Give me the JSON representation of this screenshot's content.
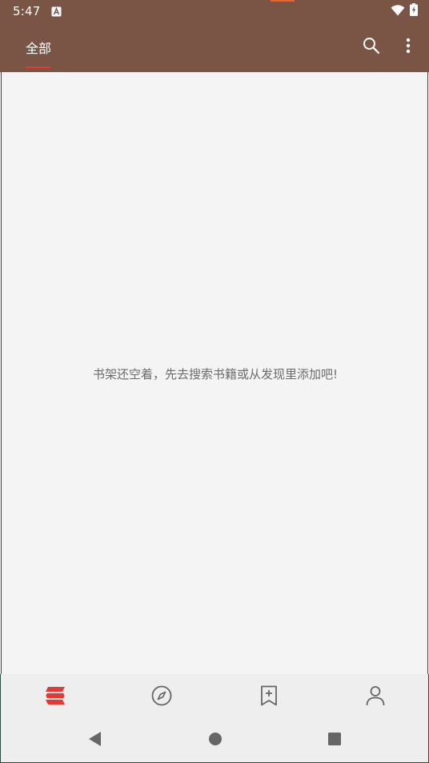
{
  "status_bar": {
    "time": "5:47",
    "icons": [
      "keyboard-a-icon",
      "wifi-icon",
      "battery-charging-icon"
    ]
  },
  "toolbar": {
    "tab_label": "全部",
    "search_icon": "search-icon",
    "more_icon": "more-vertical-icon"
  },
  "main": {
    "empty_message": "书架还空着，先去搜索书籍或从发现里添加吧!"
  },
  "bottom_nav": {
    "items": [
      {
        "icon": "bookshelf-icon",
        "active": true
      },
      {
        "icon": "compass-icon",
        "active": false
      },
      {
        "icon": "bookmark-add-icon",
        "active": false
      },
      {
        "icon": "person-icon",
        "active": false
      }
    ]
  },
  "system_nav": {
    "icons": [
      "back-triangle-icon",
      "home-circle-icon",
      "recents-square-icon"
    ]
  },
  "colors": {
    "toolbar_bg": "#7a5546",
    "accent": "#e53935",
    "icon_gray": "#666666",
    "text_gray": "#6b6b6b",
    "background": "#f4f4f4",
    "nav_bg": "#eeeeee",
    "status_orange": "#e8642a"
  }
}
